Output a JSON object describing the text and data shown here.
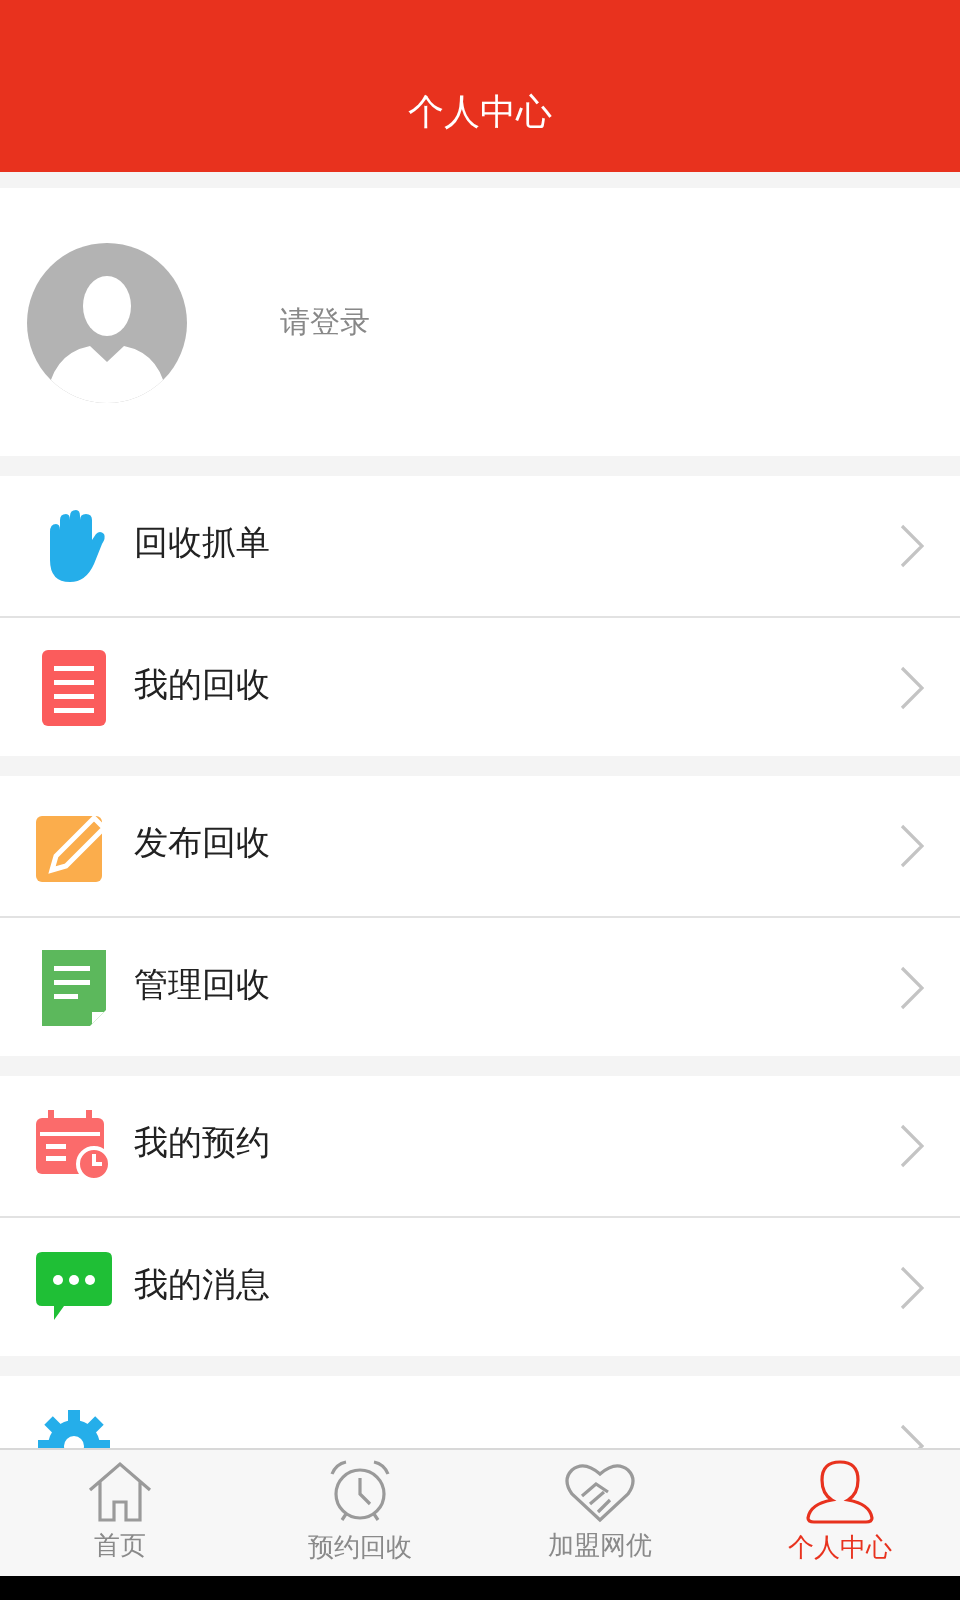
{
  "header": {
    "title": "个人中心"
  },
  "profile": {
    "login_prompt": "请登录"
  },
  "menu_groups": [
    {
      "items": [
        {
          "kind": "hand",
          "label": "回收抓单"
        },
        {
          "kind": "list",
          "label": "我的回收"
        }
      ]
    },
    {
      "items": [
        {
          "kind": "pencil",
          "label": "发布回收"
        },
        {
          "kind": "note",
          "label": "管理回收"
        }
      ]
    },
    {
      "items": [
        {
          "kind": "calendar",
          "label": "我的预约"
        },
        {
          "kind": "chat",
          "label": "我的消息"
        }
      ]
    },
    {
      "items": [
        {
          "kind": "gear"
        }
      ]
    }
  ],
  "tab_bar": [
    {
      "kind": "home",
      "label": "首页",
      "selected": false
    },
    {
      "kind": "alarm",
      "label": "预约回收",
      "selected": false
    },
    {
      "kind": "handshake",
      "label": "加盟网优",
      "selected": false
    },
    {
      "kind": "person",
      "label": "个人中心",
      "selected": true
    }
  ]
}
